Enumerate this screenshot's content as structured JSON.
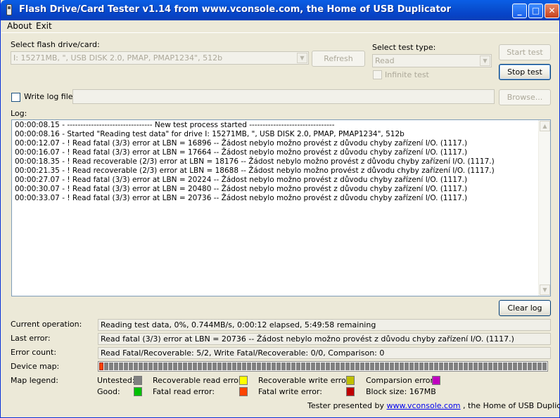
{
  "window": {
    "title": "Flash Drive/Card Tester v1.14 from www.vconsole.com, the Home of USB Duplicator",
    "min_glyph": "_",
    "max_glyph": "□",
    "close_glyph": "✕"
  },
  "menu": {
    "about": "About",
    "exit": "Exit"
  },
  "drive": {
    "label": "Select flash drive/card:",
    "selected": "I: 15271MB, \", USB DISK 2.0, PMAP, PMAP1234\", 512b",
    "refresh_label": "Refresh"
  },
  "test": {
    "label": "Select test type:",
    "selected": "Read",
    "infinite_label": "Infinite test",
    "start_label": "Start test",
    "stop_label": "Stop test"
  },
  "logfile": {
    "label": "Write log file",
    "browse_label": "Browse..."
  },
  "log": {
    "label": "Log:",
    "lines": [
      "00:00:08.15 - -------------------------------- New test process started --------------------------------",
      "00:00:08.16 - Started \"Reading test data\" for drive I: 15271MB, \", USB DISK 2.0, PMAP, PMAP1234\", 512b",
      "00:00:12.07 - ! Read fatal (3/3) error at LBN = 16896 -- Žádost nebylo možno provést z důvodu chyby zařízení I/O. (1117.)",
      "00:00:16.07 - ! Read fatal (3/3) error at LBN = 17664 -- Žádost nebylo možno provést z důvodu chyby zařízení I/O. (1117.)",
      "00:00:18.35 - ! Read recoverable (2/3) error at LBN = 18176 -- Žádost nebylo možno provést z důvodu chyby zařízení I/O. (1117.)",
      "00:00:21.35 - ! Read recoverable (2/3) error at LBN = 18688 -- Žádost nebylo možno provést z důvodu chyby zařízení I/O. (1117.)",
      "00:00:27.07 - ! Read fatal (3/3) error at LBN = 20224 -- Žádost nebylo možno provést z důvodu chyby zařízení I/O. (1117.)",
      "00:00:30.07 - ! Read fatal (3/3) error at LBN = 20480 -- Žádost nebylo možno provést z důvodu chyby zařízení I/O. (1117.)",
      "00:00:33.07 - ! Read fatal (3/3) error at LBN = 20736 -- Žádost nebylo možno provést z důvodu chyby zařízení I/O. (1117.)"
    ],
    "clear_label": "Clear log"
  },
  "status": {
    "current_label": "Current operation:",
    "current_value": "Reading test data, 0%, 0.744MB/s, 0:00:12 elapsed, 5:49:58 remaining",
    "last_error_label": "Last error:",
    "last_error_value": "Read fatal (3/3) error at LBN = 20736 -- Žádost nebylo možno provést z důvodu chyby zařízení I/O. (1117.)",
    "error_count_label": "Error count:",
    "error_count_value": "Read Fatal/Recoverable: 5/2, Write Fatal/Recoverable: 0/0, Comparison: 0"
  },
  "device_map": {
    "label": "Device map:",
    "cells_done": 1,
    "cells_total": 91,
    "done_color": "#ff4400",
    "untested_color": "#808080"
  },
  "legend": {
    "label": "Map legend:",
    "untested": "Untested:",
    "good": "Good:",
    "recoverable_read": "Recoverable read error:",
    "fatal_read": "Fatal read error:",
    "recoverable_write": "Recoverable write error:",
    "fatal_write": "Fatal write error:",
    "comparison": "Comparsion error:",
    "block_size": "Block size: 167MB",
    "colors": {
      "untested": "#808080",
      "good": "#00c000",
      "recoverable_read": "#ffff00",
      "fatal_read": "#ff4400",
      "recoverable_write": "#c0c000",
      "fatal_write": "#c00000",
      "comparison": "#c000c0"
    }
  },
  "footer": {
    "prefix": "Tester presented by",
    "link": "www.vconsole.com",
    "suffix": ", the Home of USB Duplicator."
  }
}
